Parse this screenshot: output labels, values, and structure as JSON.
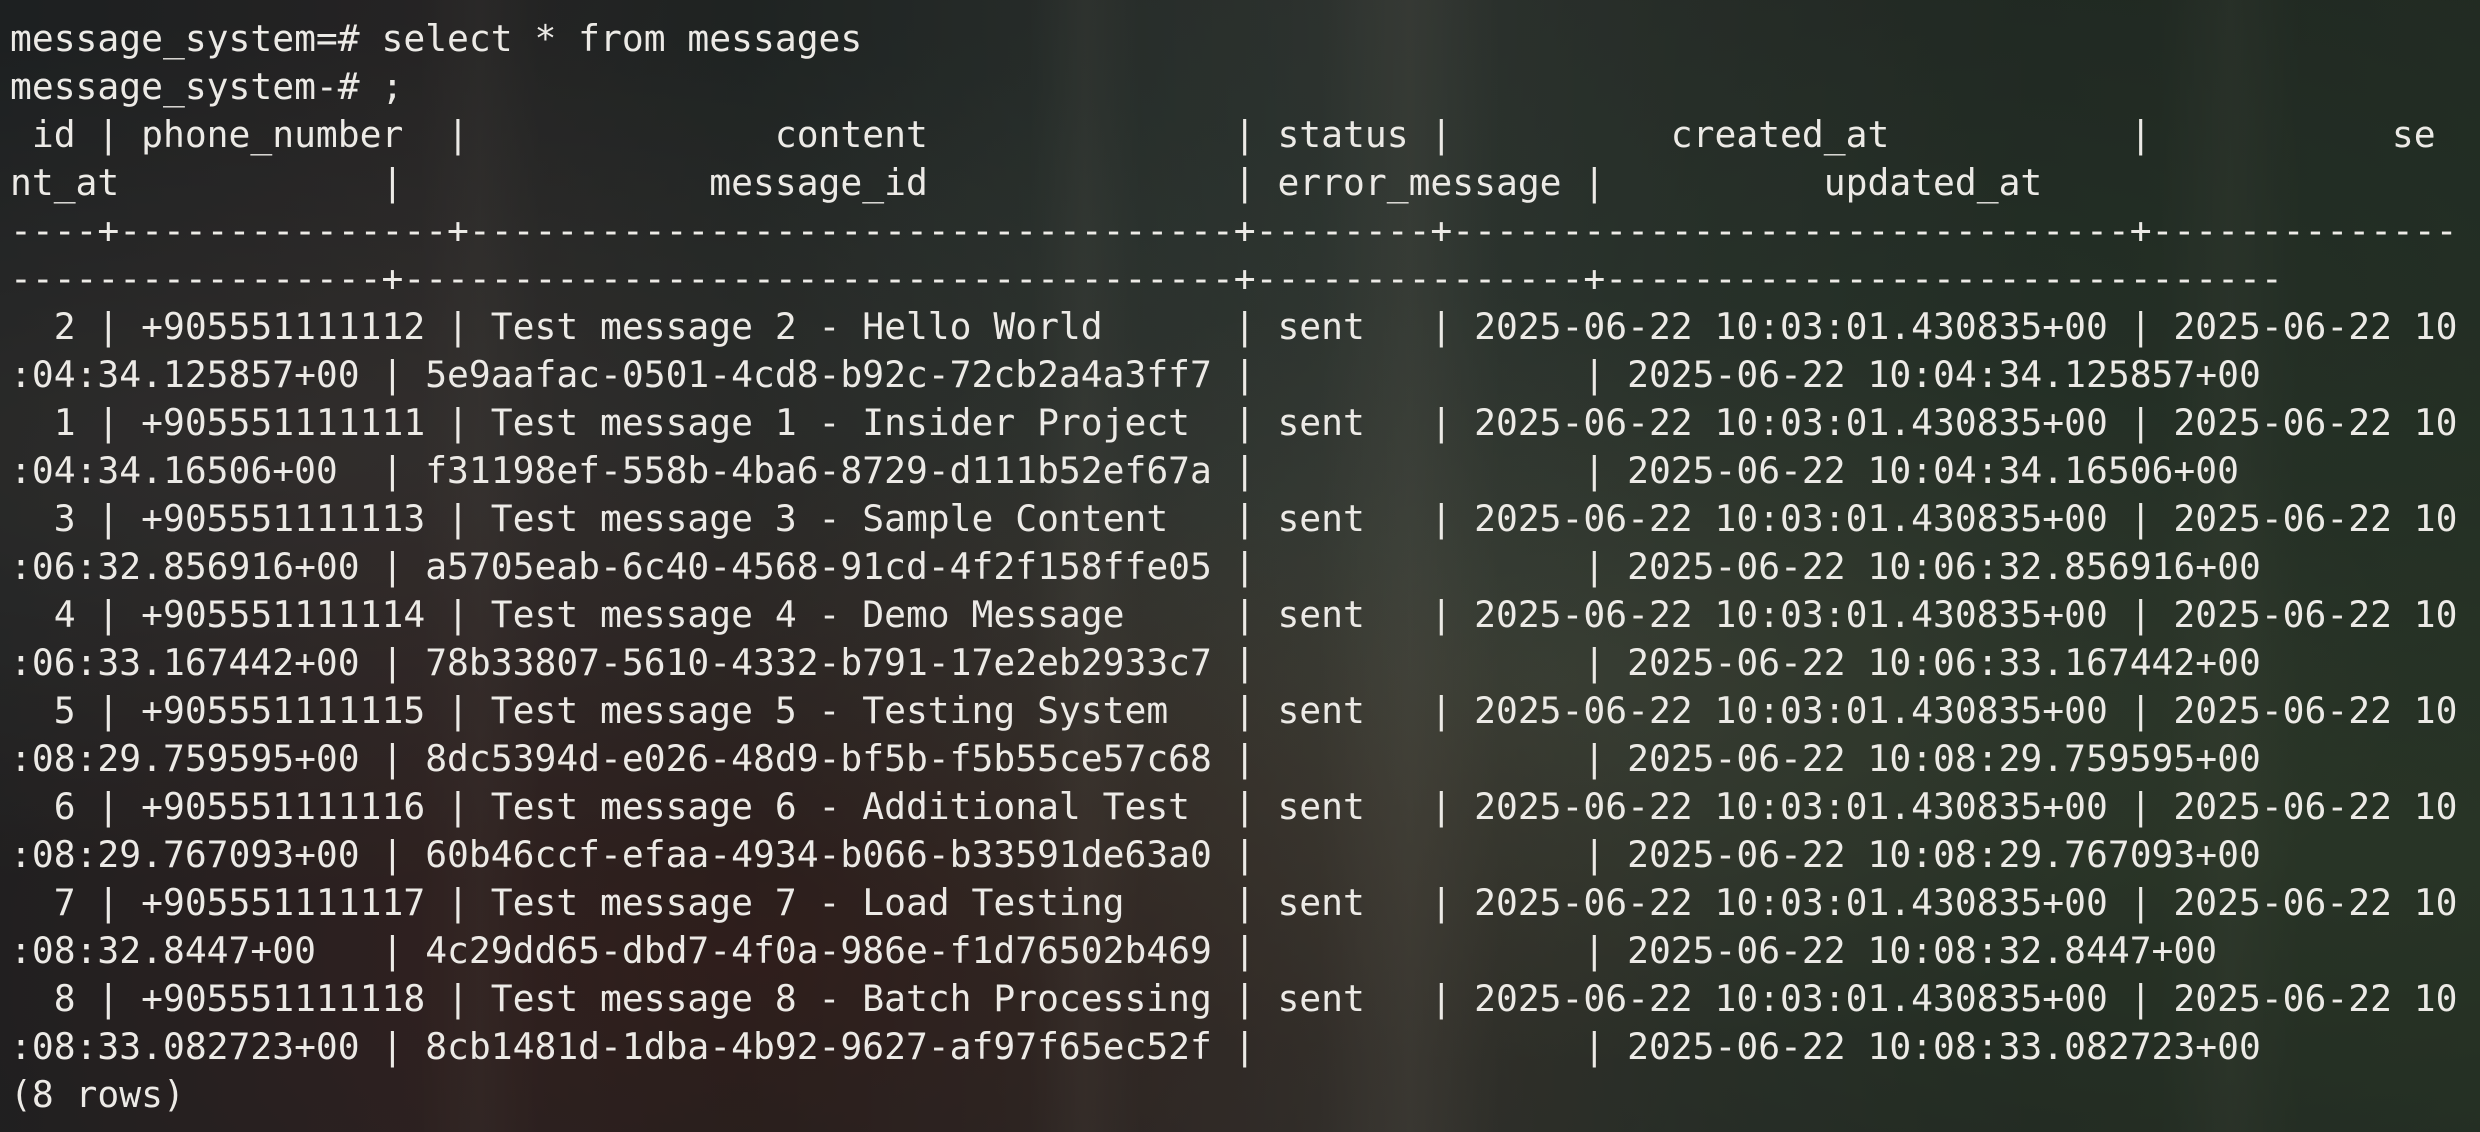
{
  "terminal": {
    "command_line_1": "message_system=# select * from messages",
    "command_line_2": "message_system-# ;",
    "header_line_1": " id | phone_number  |              content              | status |          created_at           |           se",
    "header_line_2": "nt_at            |              message_id              | error_message |          updated_at",
    "separator_line_1": "----+---------------+-----------------------------------+--------+-------------------------------+--------------",
    "separator_line_2": "-----------------+--------------------------------------+---------------+-------------------------------",
    "rows": [
      {
        "id": "2",
        "line_1": "  2 | +905551111112 | Test message 2 - Hello World      | sent   | 2025-06-22 10:03:01.430835+00 | 2025-06-22 10",
        "line_2": ":04:34.125857+00 | 5e9aafac-0501-4cd8-b92c-72cb2a4a3ff7 |               | 2025-06-22 10:04:34.125857+00"
      },
      {
        "id": "1",
        "line_1": "  1 | +905551111111 | Test message 1 - Insider Project  | sent   | 2025-06-22 10:03:01.430835+00 | 2025-06-22 10",
        "line_2": ":04:34.16506+00  | f31198ef-558b-4ba6-8729-d111b52ef67a |               | 2025-06-22 10:04:34.16506+00"
      },
      {
        "id": "3",
        "line_1": "  3 | +905551111113 | Test message 3 - Sample Content   | sent   | 2025-06-22 10:03:01.430835+00 | 2025-06-22 10",
        "line_2": ":06:32.856916+00 | a5705eab-6c40-4568-91cd-4f2f158ffe05 |               | 2025-06-22 10:06:32.856916+00"
      },
      {
        "id": "4",
        "line_1": "  4 | +905551111114 | Test message 4 - Demo Message     | sent   | 2025-06-22 10:03:01.430835+00 | 2025-06-22 10",
        "line_2": ":06:33.167442+00 | 78b33807-5610-4332-b791-17e2eb2933c7 |               | 2025-06-22 10:06:33.167442+00"
      },
      {
        "id": "5",
        "line_1": "  5 | +905551111115 | Test message 5 - Testing System   | sent   | 2025-06-22 10:03:01.430835+00 | 2025-06-22 10",
        "line_2": ":08:29.759595+00 | 8dc5394d-e026-48d9-bf5b-f5b55ce57c68 |               | 2025-06-22 10:08:29.759595+00"
      },
      {
        "id": "6",
        "line_1": "  6 | +905551111116 | Test message 6 - Additional Test  | sent   | 2025-06-22 10:03:01.430835+00 | 2025-06-22 10",
        "line_2": ":08:29.767093+00 | 60b46ccf-efaa-4934-b066-b33591de63a0 |               | 2025-06-22 10:08:29.767093+00"
      },
      {
        "id": "7",
        "line_1": "  7 | +905551111117 | Test message 7 - Load Testing     | sent   | 2025-06-22 10:03:01.430835+00 | 2025-06-22 10",
        "line_2": ":08:32.8447+00   | 4c29dd65-dbd7-4f0a-986e-f1d76502b469 |               | 2025-06-22 10:08:32.8447+00"
      },
      {
        "id": "8",
        "line_1": "  8 | +905551111118 | Test message 8 - Batch Processing | sent   | 2025-06-22 10:03:01.430835+00 | 2025-06-22 10",
        "line_2": ":08:33.082723+00 | 8cb1481d-1dba-4b92-9627-af97f65ec52f |               | 2025-06-22 10:08:33.082723+00"
      }
    ],
    "row_count": "(8 rows)"
  },
  "colors": {
    "text": "#eceae6"
  }
}
